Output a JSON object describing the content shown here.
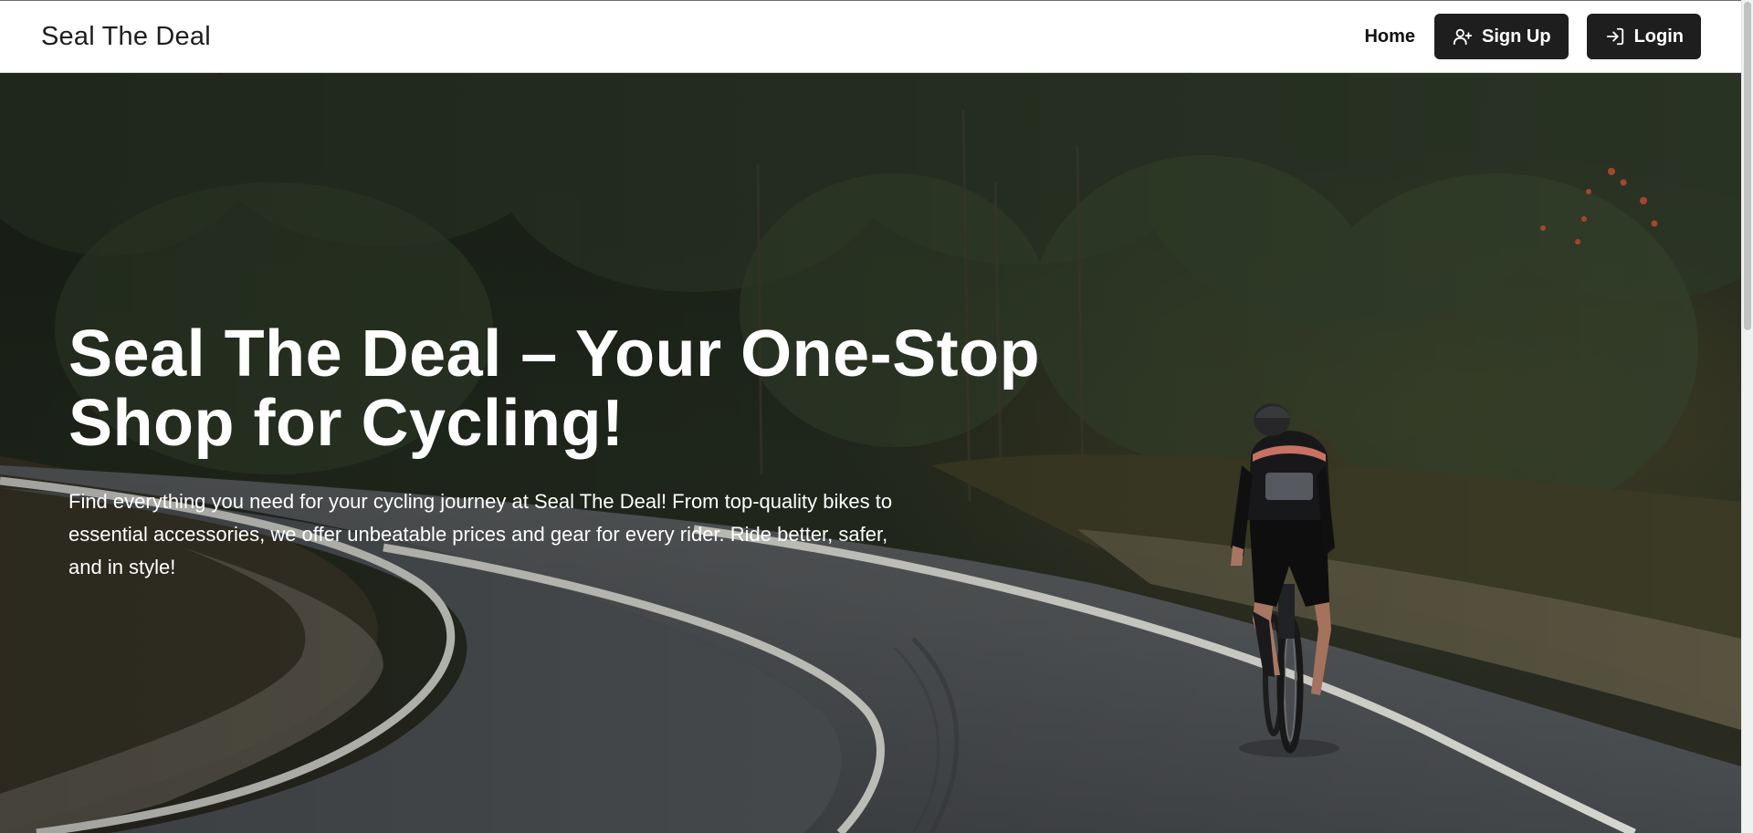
{
  "navbar": {
    "brand": "Seal The Deal",
    "home_label": "Home",
    "signup_label": "Sign Up",
    "login_label": "Login"
  },
  "hero": {
    "title_line1": "Seal The Deal – Your One-Stop",
    "title_line2": "Shop for Cycling!",
    "description": "Find everything you need for your cycling journey at Seal The Deal! From top-quality bikes to essential accessories, we offer unbeatable prices and gear for every rider. Ride better, safer, and in style!"
  },
  "icons": {
    "signup": "user-plus-icon",
    "login": "login-arrow-icon"
  },
  "colors": {
    "button_bg": "#1e1e1e",
    "button_text": "#ffffff",
    "hero_text": "#ffffff"
  }
}
